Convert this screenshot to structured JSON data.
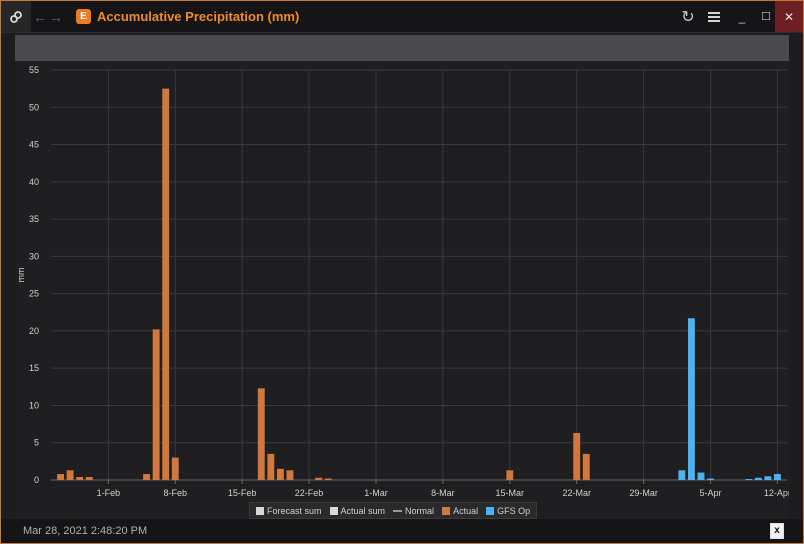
{
  "window": {
    "title": "Accumulative Precipitation (mm)",
    "app_icon_glyph": "E",
    "icons": {
      "link": "link-icon",
      "back": "arrow-left-icon",
      "forward": "arrow-right-icon",
      "refresh": "refresh-icon",
      "menu": "hamburger-menu-icon",
      "minimize": "minimize-icon",
      "maximize": "maximize-icon",
      "close": "close-icon"
    },
    "glyphs": {
      "back": "←",
      "forward": "→",
      "refresh": "↻",
      "minimize": "_",
      "maximize": "☐",
      "close": "✕"
    },
    "accent_color": "#f08a2c"
  },
  "status": {
    "timestamp": "Mar 28, 2021 2:48:20 PM",
    "export_icon": "export-excel-icon",
    "export_glyph": "x"
  },
  "chart_data": {
    "type": "bar",
    "ylabel": "mm",
    "ylim": [
      0,
      55
    ],
    "yticks": [
      0,
      5,
      10,
      15,
      20,
      25,
      30,
      35,
      40,
      45,
      50,
      55
    ],
    "xlim": [
      "2021-01-26",
      "2021-04-13"
    ],
    "xticks": [
      "1-Feb",
      "8-Feb",
      "15-Feb",
      "22-Feb",
      "1-Mar",
      "8-Mar",
      "15-Mar",
      "22-Mar",
      "29-Mar",
      "5-Apr",
      "12-Apr"
    ],
    "xtick_dates": [
      "2021-02-01",
      "2021-02-08",
      "2021-02-15",
      "2021-02-22",
      "2021-03-01",
      "2021-03-08",
      "2021-03-15",
      "2021-03-22",
      "2021-03-29",
      "2021-04-05",
      "2021-04-12"
    ],
    "grid": true,
    "legend_position": "bottom-center",
    "legend": [
      {
        "name": "Forecast sum",
        "kind": "box",
        "color": "#d9d9d9"
      },
      {
        "name": "Actual sum",
        "kind": "box",
        "color": "#d9d9d9"
      },
      {
        "name": "Normal",
        "kind": "line",
        "color": "#9a9a9a"
      },
      {
        "name": "Actual",
        "kind": "box",
        "color": "#d2783f"
      },
      {
        "name": "GFS Op",
        "kind": "box",
        "color": "#4db3f0"
      }
    ],
    "series": [
      {
        "name": "Actual",
        "color": "#d2783f",
        "points": [
          [
            "2021-01-27",
            0.8
          ],
          [
            "2021-01-28",
            1.3
          ],
          [
            "2021-01-29",
            0.4
          ],
          [
            "2021-01-30",
            0.4
          ],
          [
            "2021-02-05",
            0.8
          ],
          [
            "2021-02-06",
            20.2
          ],
          [
            "2021-02-07",
            52.5
          ],
          [
            "2021-02-08",
            3.0
          ],
          [
            "2021-02-17",
            12.3
          ],
          [
            "2021-02-18",
            3.5
          ],
          [
            "2021-02-19",
            1.5
          ],
          [
            "2021-02-20",
            1.3
          ],
          [
            "2021-02-23",
            0.3
          ],
          [
            "2021-02-24",
            0.2
          ],
          [
            "2021-03-15",
            1.3
          ],
          [
            "2021-03-22",
            6.3
          ],
          [
            "2021-03-23",
            3.5
          ]
        ]
      },
      {
        "name": "GFS Op",
        "color": "#4db3f0",
        "points": [
          [
            "2021-04-02",
            1.3
          ],
          [
            "2021-04-03",
            21.7
          ],
          [
            "2021-04-04",
            1.0
          ],
          [
            "2021-04-05",
            0.2
          ],
          [
            "2021-04-09",
            0.1
          ],
          [
            "2021-04-10",
            0.3
          ],
          [
            "2021-04-11",
            0.5
          ],
          [
            "2021-04-12",
            0.8
          ]
        ]
      }
    ]
  }
}
